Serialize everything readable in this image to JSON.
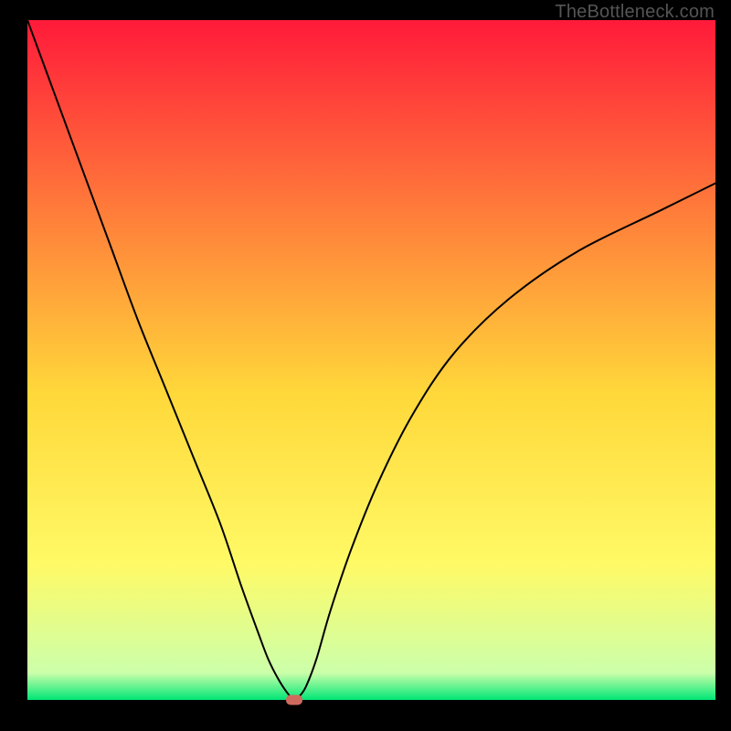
{
  "watermark": "TheBottleneck.com",
  "chart_data": {
    "type": "line",
    "title": "",
    "xlabel": "",
    "ylabel": "",
    "xlim": [
      0,
      100
    ],
    "ylim": [
      0,
      100
    ],
    "background_gradient": {
      "top": "#ff1a3a",
      "mid_upper": "#ff7c3a",
      "mid": "#ffd83a",
      "mid_lower": "#fffa66",
      "near_bottom": "#ccffaa",
      "bottom": "#00e676"
    },
    "series": [
      {
        "name": "bottleneck-curve",
        "color": "#000000",
        "stroke_width": 2,
        "x": [
          0,
          4,
          8,
          12,
          16,
          20,
          24,
          28,
          31,
          33.5,
          35,
          36.5,
          37.8,
          38.8,
          39.5,
          40.5,
          42,
          44,
          47,
          51,
          56,
          62,
          70,
          80,
          92,
          100
        ],
        "y": [
          100,
          89,
          78,
          67,
          56,
          46,
          36,
          26,
          17,
          10,
          6,
          3,
          1,
          0,
          0.5,
          2,
          6,
          13,
          22,
          32,
          42,
          51,
          59,
          66,
          72,
          76
        ]
      }
    ],
    "marker": {
      "name": "optimal-point",
      "x": 38.8,
      "y": 0,
      "color": "#cf6b5e"
    }
  }
}
